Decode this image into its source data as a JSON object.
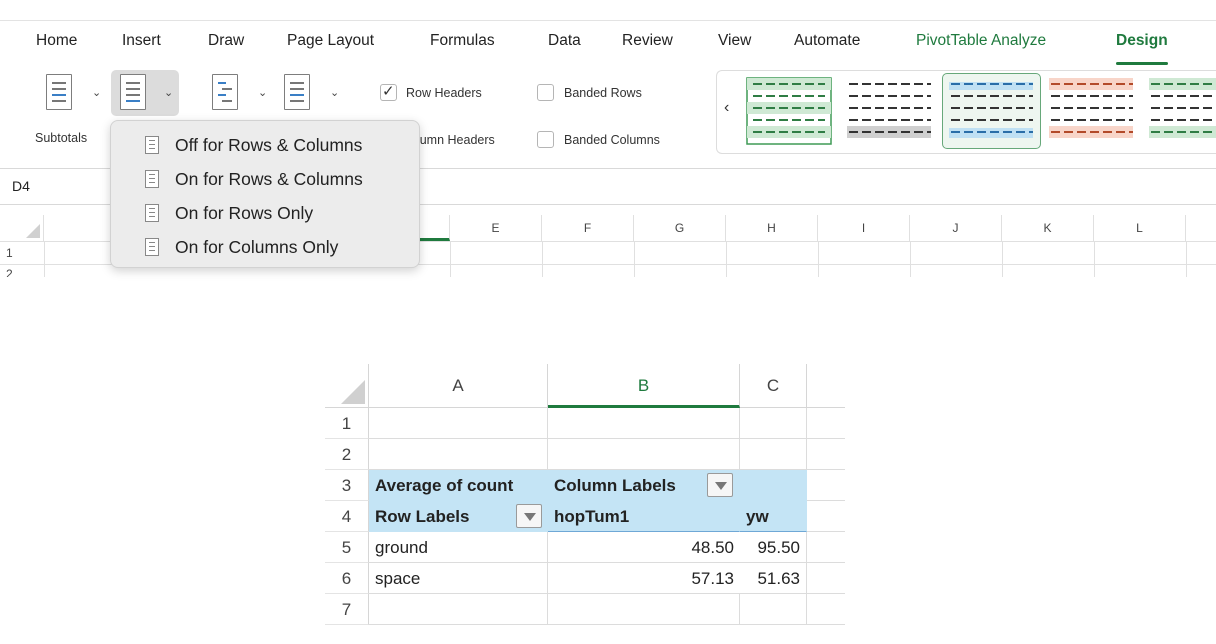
{
  "ribbon_tabs": [
    "Home",
    "Insert",
    "Draw",
    "Page Layout",
    "Formulas",
    "Data",
    "Review",
    "View",
    "Automate",
    "PivotTable Analyze",
    "Design"
  ],
  "active_tab": "Design",
  "ribbon": {
    "subtotals_label": "Subtotals",
    "row_headers_label": "Row Headers",
    "column_headers_label": "olumn Headers",
    "banded_rows_label": "Banded Rows",
    "banded_columns_label": "Banded Columns",
    "row_headers_checked": true,
    "banded_rows_checked": false,
    "banded_columns_checked": false,
    "gallery_prev": "‹"
  },
  "grand_totals_menu": {
    "items": [
      "Off for Rows & Columns",
      "On for Rows & Columns",
      "On for Rows Only",
      "On for Columns Only"
    ]
  },
  "formula_bar": {
    "name_box": "D4"
  },
  "top_grid": {
    "columns": [
      "E",
      "F",
      "G",
      "H",
      "I",
      "J",
      "K",
      "L"
    ],
    "rows": [
      "1",
      "2"
    ]
  },
  "pivot_view": {
    "columns": [
      "A",
      "B",
      "C"
    ],
    "selected_column": "B",
    "rows": [
      "1",
      "2",
      "3",
      "4",
      "5",
      "6",
      "7"
    ],
    "cells": {
      "a3": "Average of count",
      "b3": "Column Labels",
      "a4": "Row Labels",
      "b4": "hopTum1",
      "c4": "yw",
      "a5": "ground",
      "b5": "48.50",
      "c5": "95.50",
      "a6": "space",
      "b6": "57.13",
      "c6": "51.63"
    }
  },
  "colors": {
    "accent_green": "#1f7a3e",
    "pivot_header_bg": "#c4e4f5"
  }
}
